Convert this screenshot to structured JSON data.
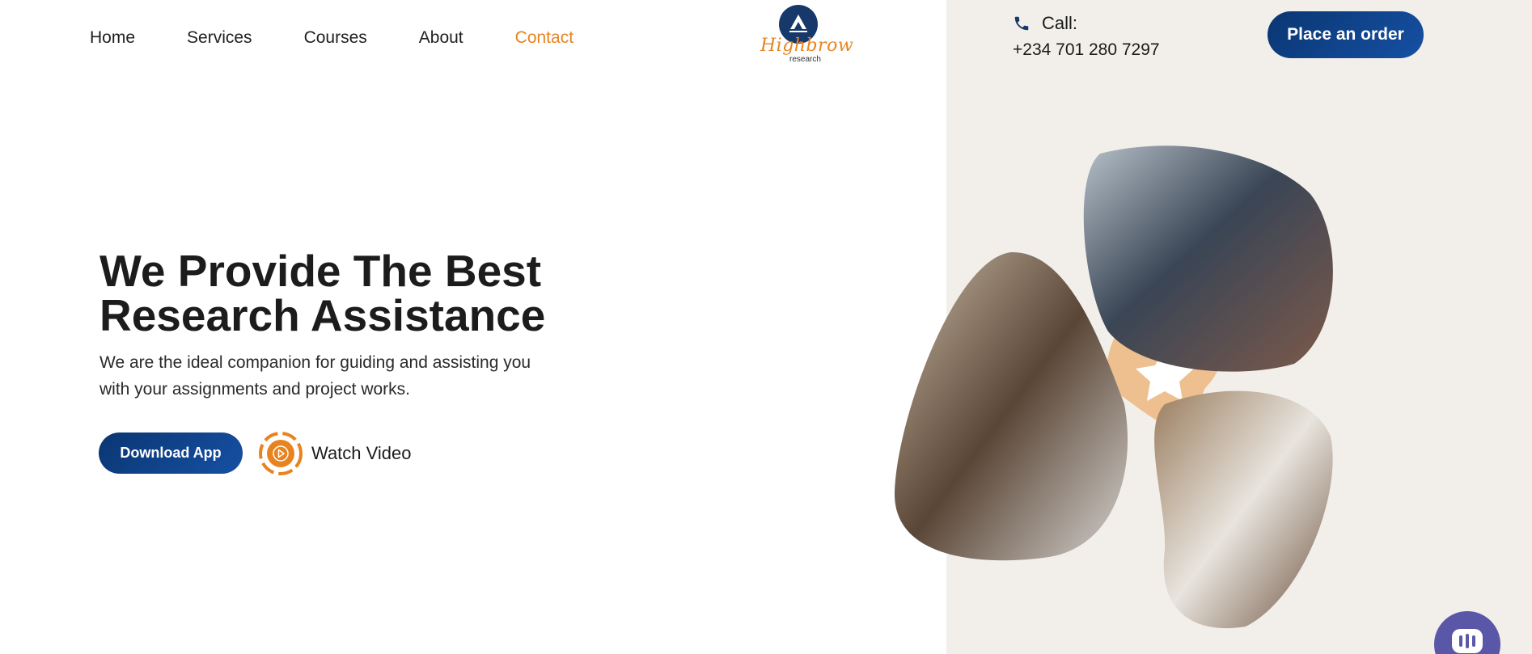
{
  "nav": {
    "items": [
      {
        "label": "Home"
      },
      {
        "label": "Services"
      },
      {
        "label": "Courses"
      },
      {
        "label": "About"
      },
      {
        "label": "Contact"
      }
    ],
    "active_index": 4
  },
  "logo": {
    "brand": "Highbrow",
    "sub": "research"
  },
  "contact": {
    "label": "Call:",
    "phone": "+234 701 280 7297"
  },
  "header": {
    "order_label": "Place an order"
  },
  "hero": {
    "title_line1": "We Provide The Best",
    "title_line2": "Research Assistance",
    "subtitle": "We are the ideal companion for guiding and assisting you with your assignments and project works.",
    "download_label": "Download App",
    "watch_label": "Watch Video"
  },
  "icons": {
    "phone": "phone-icon",
    "play": "play-icon",
    "chat": "chat-icon",
    "logo_mark": "mountain-logo-icon"
  },
  "colors": {
    "accent": "#e88420",
    "brand_blue": "#0a3672",
    "panel_bg": "#f2efea",
    "chat_purple": "#5b57a8"
  }
}
